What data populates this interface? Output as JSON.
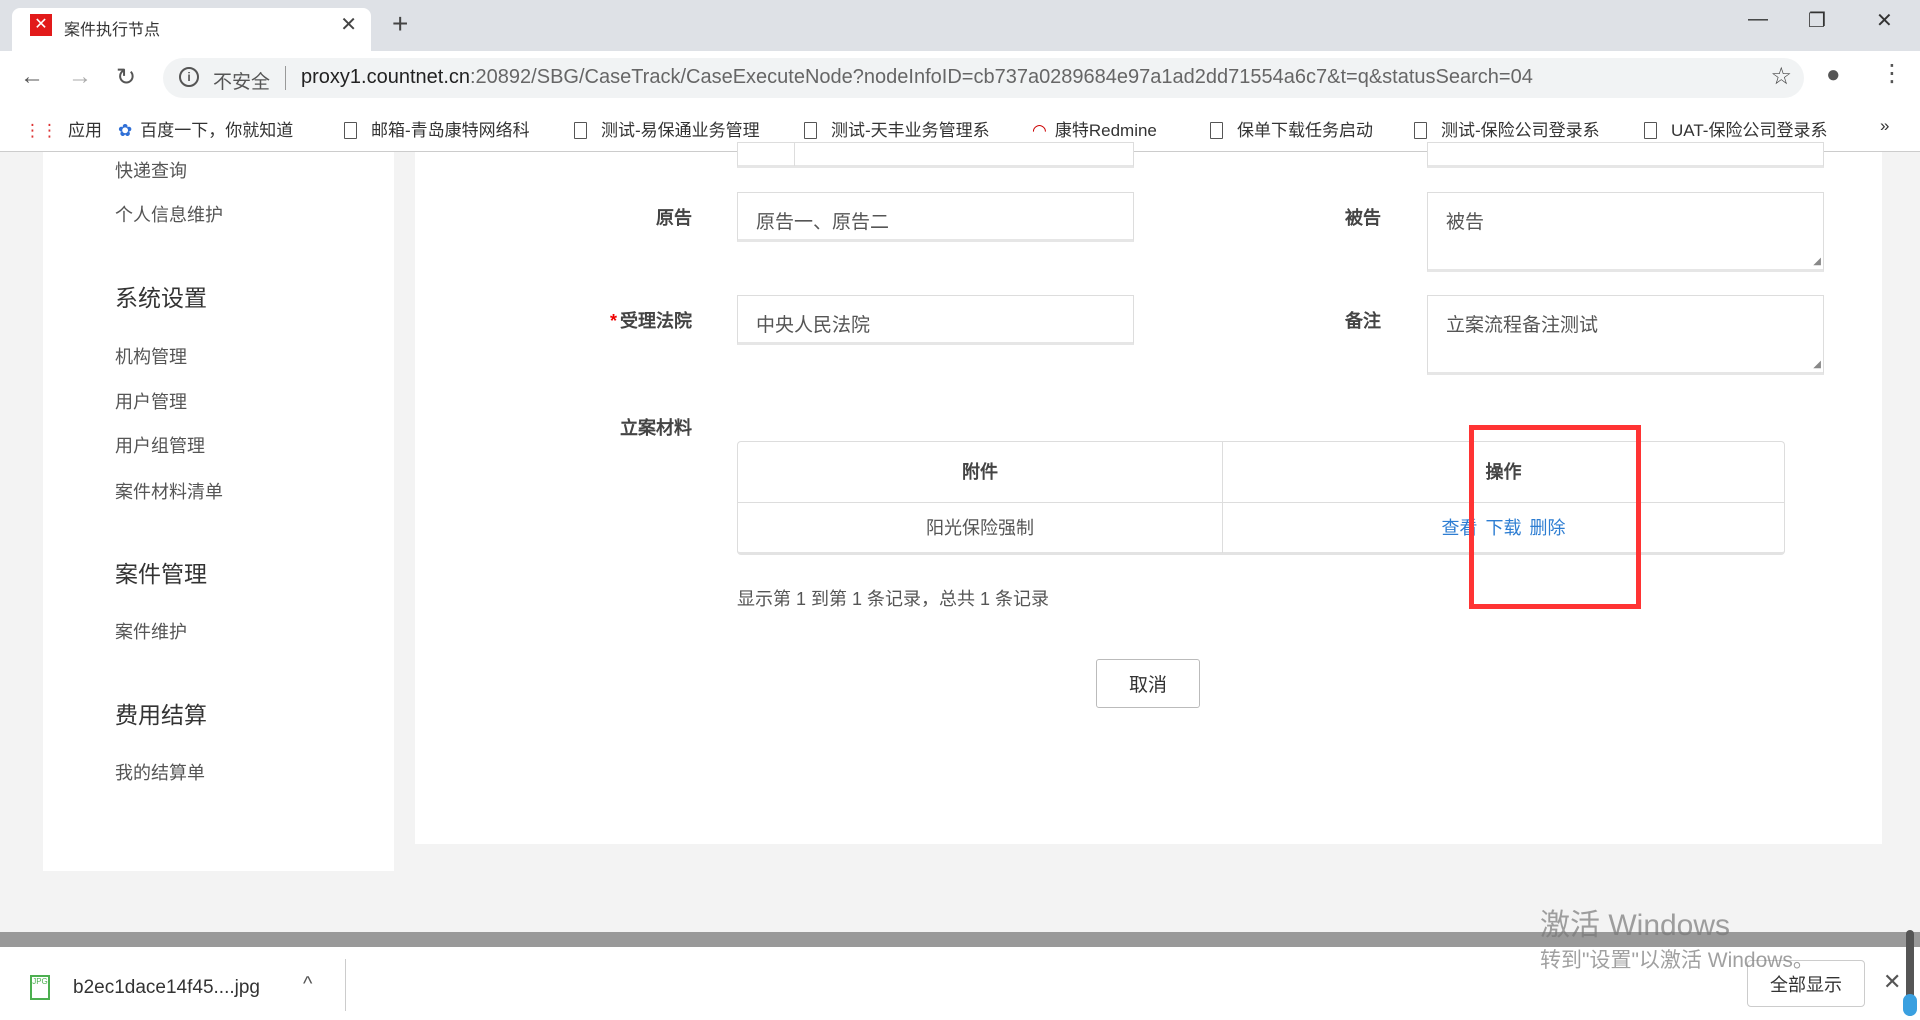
{
  "browser": {
    "tab_title": "案件执行节点",
    "insecure_label": "不安全",
    "url_host": "proxy1.countnet.cn",
    "url_rest": ":20892/SBG/CaseTrack/CaseExecuteNode?nodeInfoID=cb737a0289684e97a1ad2dd71554a6c7&t=q&statusSearch=04"
  },
  "bookmarks": [
    "应用",
    "百度一下，你就知道",
    "邮箱-青岛康特网络科",
    "测试-易保通业务管理",
    "测试-天丰业务管理系",
    "康特Redmine",
    "保单下载任务启动",
    "测试-保险公司登录系",
    "UAT-保险公司登录系"
  ],
  "sidebar": {
    "items_top": [
      "快递查询",
      "个人信息维护"
    ],
    "sections": [
      {
        "title": "系统设置",
        "items": [
          "机构管理",
          "用户管理",
          "用户组管理",
          "案件材料清单"
        ]
      },
      {
        "title": "案件管理",
        "items": [
          "案件维护"
        ]
      },
      {
        "title": "费用结算",
        "items": [
          "我的结算单"
        ]
      }
    ]
  },
  "form": {
    "plaintiff_label": "原告",
    "plaintiff_value": "原告一、原告二",
    "defendant_label": "被告",
    "defendant_value": "被告",
    "court_label": "受理法院",
    "court_value": "中央人民法院",
    "remark_label": "备注",
    "remark_value": "立案流程备注测试",
    "materials_label": "立案材料"
  },
  "table": {
    "headers": [
      "附件",
      "操作"
    ],
    "rows": [
      {
        "attachment": "阳光保险强制",
        "actions": [
          "查看",
          "下载",
          "删除"
        ]
      }
    ],
    "pagination": "显示第 1 到第 1 条记录，总共 1 条记录"
  },
  "cancel_label": "取消",
  "download": {
    "filename": "b2ec1dace14f45....jpg",
    "show_all": "全部显示"
  },
  "watermark": {
    "line1": "激活 Windows",
    "line2": "转到\"设置\"以激活 Windows。"
  }
}
